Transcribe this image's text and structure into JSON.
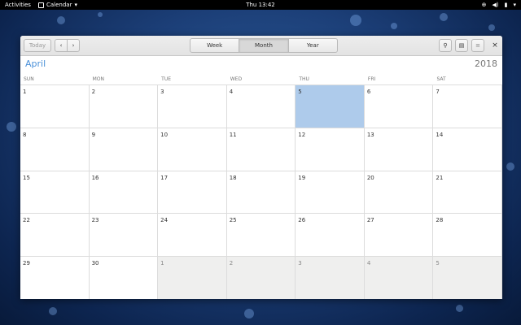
{
  "topbar": {
    "activities": "Activities",
    "app_name": "Calendar",
    "clock": "Thu 13:42"
  },
  "toolbar": {
    "today_label": "Today",
    "views": [
      "Week",
      "Month",
      "Year"
    ],
    "active_view": "Month"
  },
  "header": {
    "month": "April",
    "year": "2018"
  },
  "weekdays": [
    "SUN",
    "MON",
    "TUE",
    "WED",
    "THU",
    "FRI",
    "SAT"
  ],
  "weeks": [
    [
      "1",
      "2",
      "3",
      "4",
      "5",
      "6",
      "7"
    ],
    [
      "8",
      "9",
      "10",
      "11",
      "12",
      "13",
      "14"
    ],
    [
      "15",
      "16",
      "17",
      "18",
      "19",
      "20",
      "21"
    ],
    [
      "22",
      "23",
      "24",
      "25",
      "26",
      "27",
      "28"
    ],
    [
      "29",
      "30",
      "1",
      "2",
      "3",
      "4",
      "5"
    ]
  ],
  "today_day": "5",
  "colors": {
    "accent": "#4a90d9",
    "today_highlight": "#aecbeb",
    "other_month": "#efefee"
  }
}
